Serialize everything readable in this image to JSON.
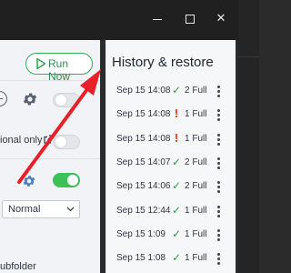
{
  "window": {
    "close_glyph": "✕"
  },
  "left_panel": {
    "run_now_label": "Run Now",
    "option_label_partial": "ional only",
    "dropdown_value": "Normal",
    "subfolder_label_partial": "ubfolder"
  },
  "history": {
    "title": "History & restore",
    "items": [
      {
        "datetime": "Sep 15 14:08",
        "status": "ok",
        "status_glyph": "✓",
        "count": "2 Full"
      },
      {
        "datetime": "Sep 15 14:08",
        "status": "warn",
        "status_glyph": "!",
        "count": "1 Full"
      },
      {
        "datetime": "Sep 15 14:08",
        "status": "warn",
        "status_glyph": "!",
        "count": "1 Full"
      },
      {
        "datetime": "Sep 15 14:07",
        "status": "ok",
        "status_glyph": "✓",
        "count": "2 Full"
      },
      {
        "datetime": "Sep 15 14:06",
        "status": "ok",
        "status_glyph": "✓",
        "count": "2 Full"
      },
      {
        "datetime": "Sep 15 12:44",
        "status": "ok",
        "status_glyph": "✓",
        "count": "1 Full"
      },
      {
        "datetime": "Sep 15 1:09",
        "status": "ok",
        "status_glyph": "✓",
        "count": "1 Full"
      },
      {
        "datetime": "Sep 15 1:08",
        "status": "ok",
        "status_glyph": "✓",
        "count": "1 Full"
      }
    ]
  },
  "colors": {
    "accent_green": "#3cc15a",
    "ok_green": "#2e9f48",
    "warn_orange": "#e0532b",
    "annotation_arrow": "#e8202a",
    "titlebar": "#202020"
  },
  "icons": [
    "play-icon",
    "plus-circle-icon",
    "gear-icon",
    "external-link-icon",
    "chevron-down-icon",
    "check-icon",
    "exclamation-icon",
    "kebab-icon"
  ]
}
